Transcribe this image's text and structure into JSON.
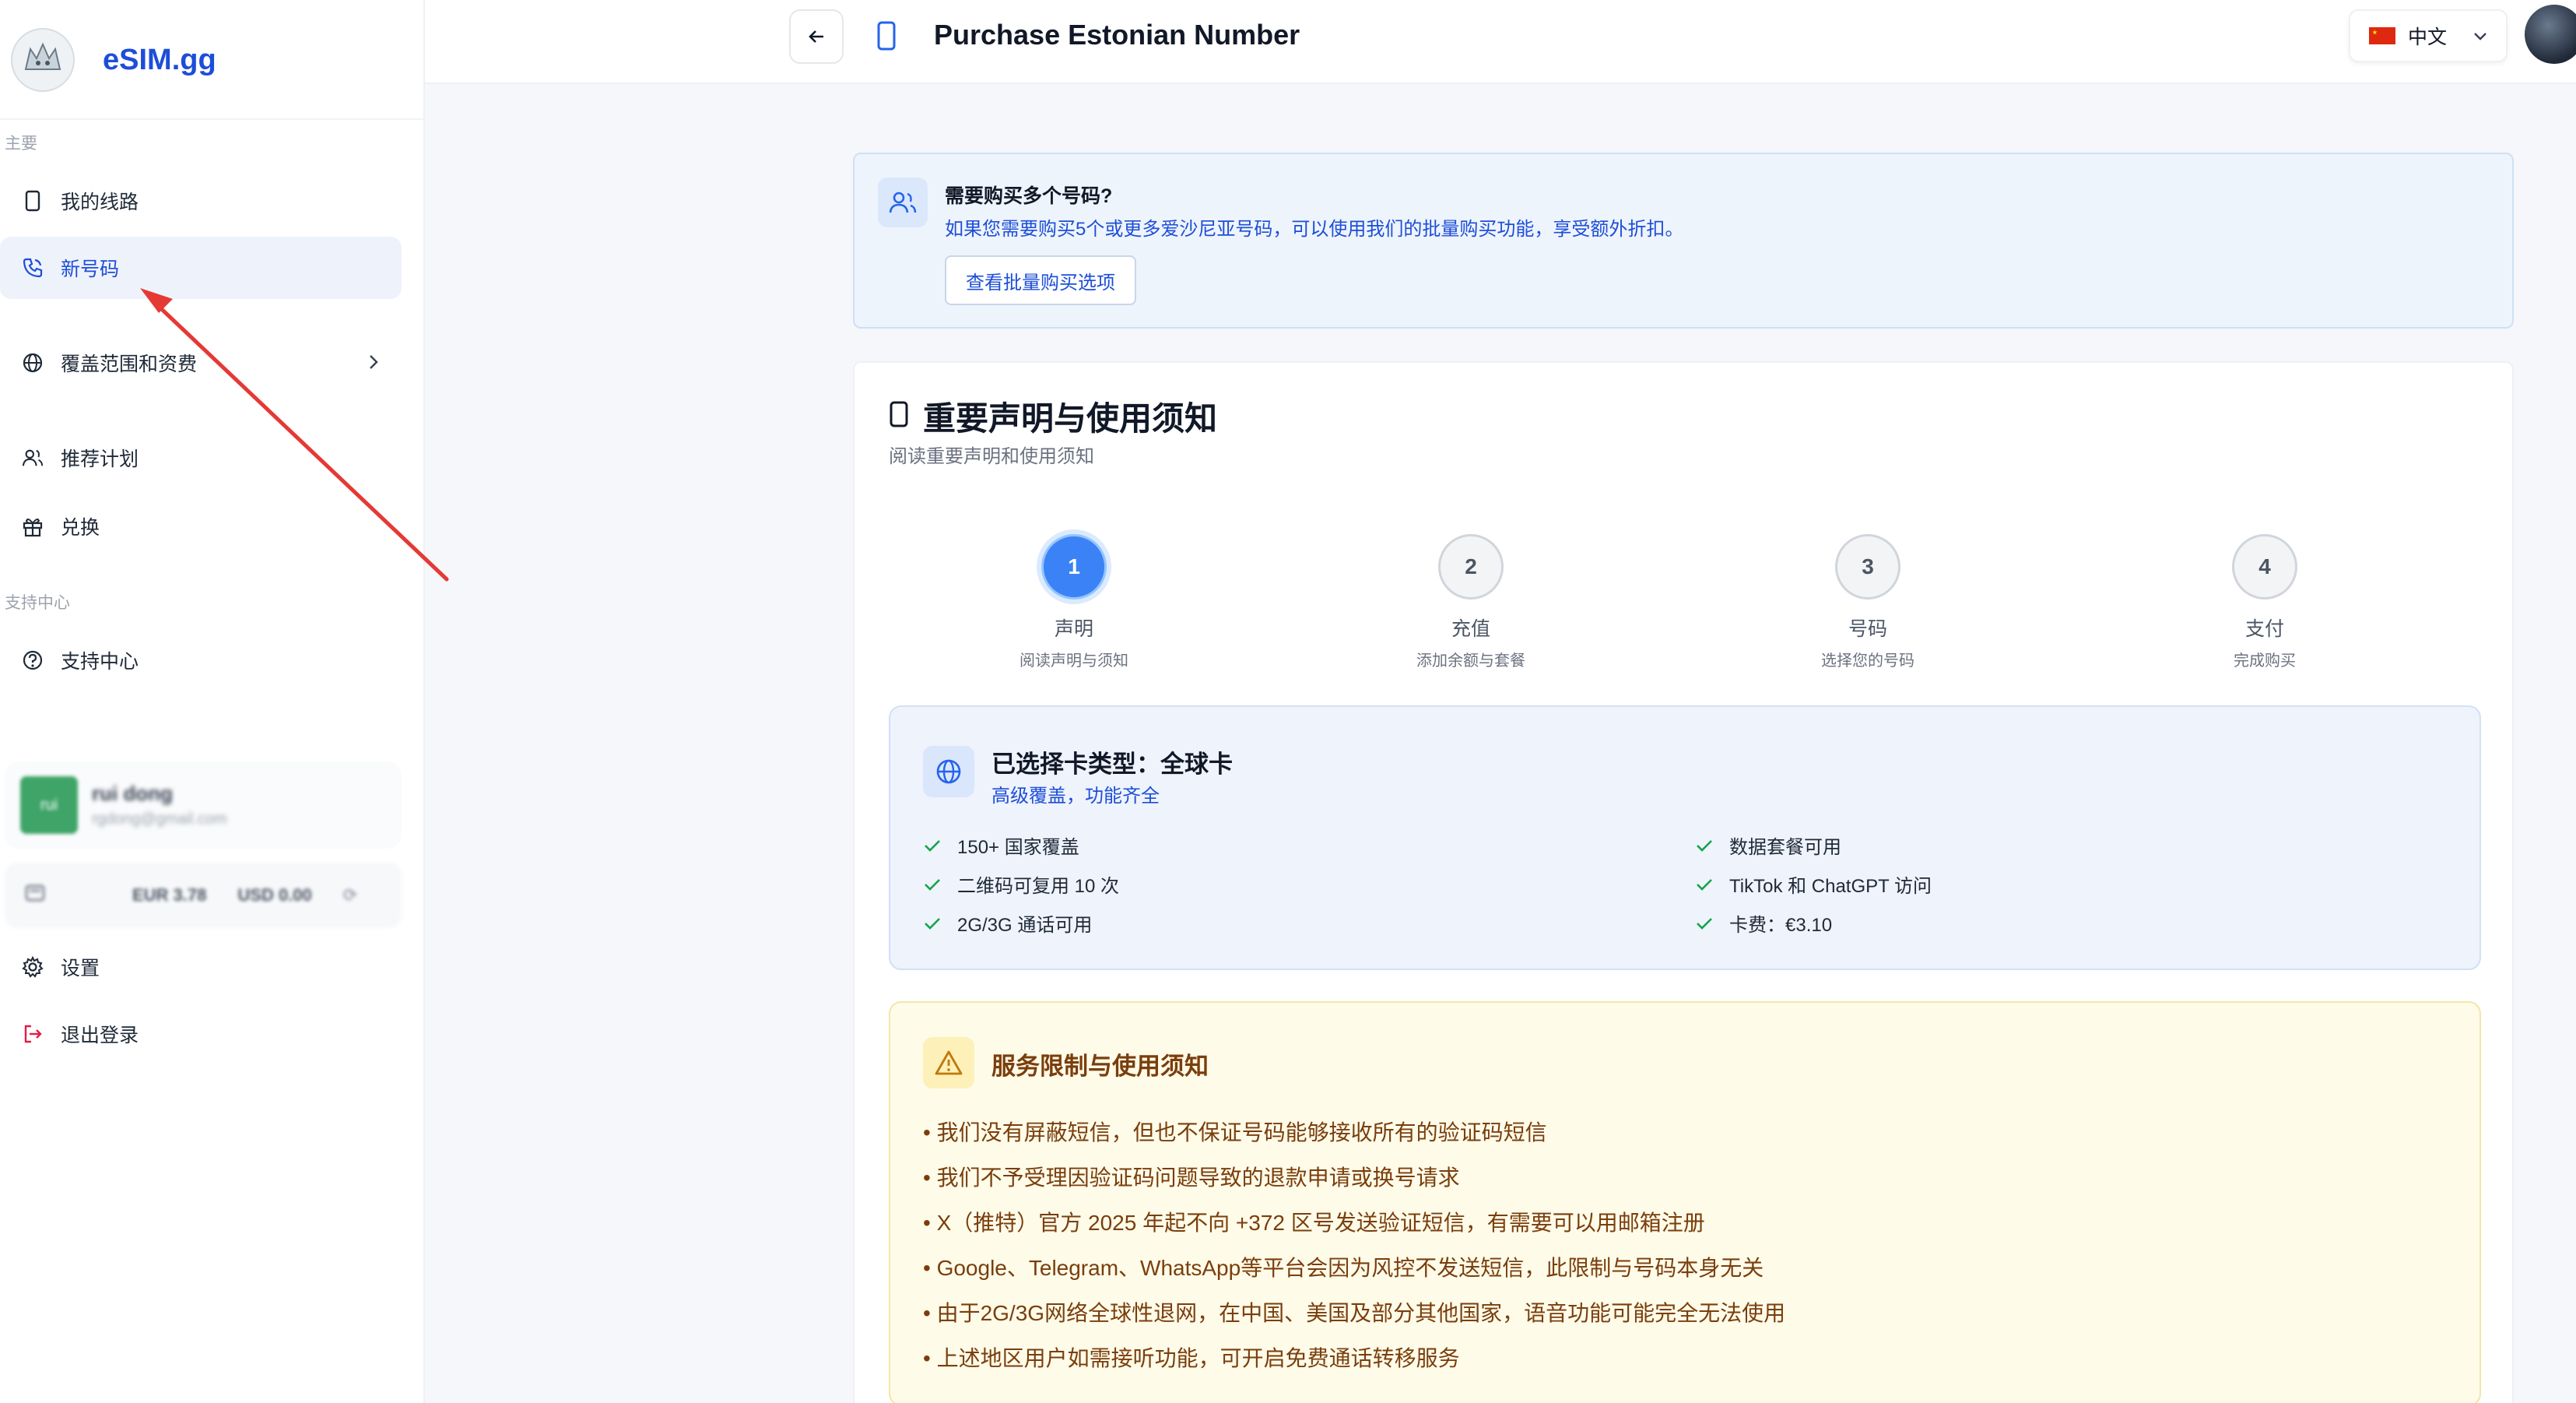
{
  "brand": {
    "name": "eSIM.gg"
  },
  "sidebar": {
    "section_main": "主要",
    "section_support": "支持中心",
    "items": [
      {
        "label": "我的线路"
      },
      {
        "label": "新号码"
      },
      {
        "label": "覆盖范围和资费"
      },
      {
        "label": "推荐计划"
      },
      {
        "label": "兑换"
      },
      {
        "label": "支持中心"
      },
      {
        "label": "设置"
      },
      {
        "label": "退出登录"
      }
    ],
    "user": {
      "initials": "rui",
      "name": "rui dong",
      "email": "rgdong@gmail.com"
    },
    "balance": {
      "eur": "EUR 3.78",
      "usd": "USD 0.00"
    }
  },
  "header": {
    "title": "Purchase Estonian Number",
    "language": "中文"
  },
  "bulk": {
    "title": "需要购买多个号码?",
    "description": "如果您需要购买5个或更多爱沙尼亚号码，可以使用我们的批量购买功能，享受额外折扣。",
    "button": "查看批量购买选项"
  },
  "card": {
    "title": "重要声明与使用须知",
    "subtitle": "阅读重要声明和使用须知"
  },
  "steps": [
    {
      "num": "1",
      "label": "声明",
      "sub": "阅读声明与须知"
    },
    {
      "num": "2",
      "label": "充值",
      "sub": "添加余额与套餐"
    },
    {
      "num": "3",
      "label": "号码",
      "sub": "选择您的号码"
    },
    {
      "num": "4",
      "label": "支付",
      "sub": "完成购买"
    }
  ],
  "sim": {
    "title": "已选择卡类型：全球卡",
    "subtitle": "高级覆盖，功能齐全",
    "features_left": [
      "150+ 国家覆盖",
      "二维码可复用 10 次",
      "2G/3G 通话可用"
    ],
    "features_right": [
      "数据套餐可用",
      "TikTok 和 ChatGPT 访问",
      "卡费：€3.10"
    ]
  },
  "notice": {
    "title": "服务限制与使用须知",
    "items": [
      "• 我们没有屏蔽短信，但也不保证号码能够接收所有的验证码短信",
      "• 我们不予受理因验证码问题导致的退款申请或换号请求",
      "• X（推特）官方 2025 年起不向 +372 区号发送验证短信，有需要可以用邮箱注册",
      "• Google、Telegram、WhatsApp等平台会因为风控不发送短信，此限制与号码本身无关",
      "• 由于2G/3G网络全球性退网，在中国、美国及部分其他国家，语音功能可能完全无法使用",
      "• 上述地区用户如需接听功能，可开启免费通话转移服务"
    ]
  },
  "colors": {
    "accent": "#1d4ed8",
    "step_active": "#3b82f6",
    "warning_text": "#7a3e0c",
    "annotation": "#e53935"
  }
}
